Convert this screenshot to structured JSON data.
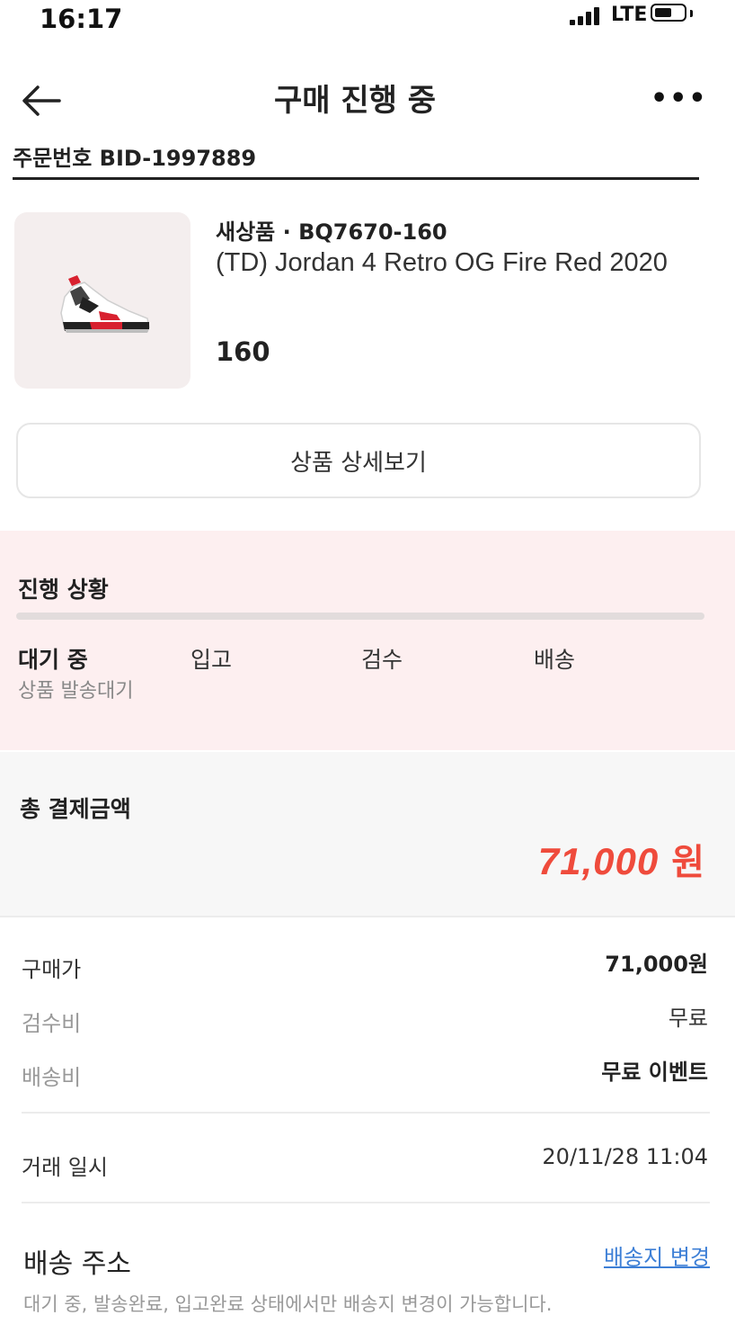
{
  "status_bar": {
    "time": "16:17",
    "network": "LTE",
    "signal_icon": "signal-bars-icon",
    "battery_icon": "battery-icon"
  },
  "header": {
    "title": "구매 진행 중",
    "back_icon": "back-arrow-icon",
    "more_icon": "more-dots-icon",
    "more_glyph": "•••"
  },
  "order": {
    "number_text": "주문번호 BID-1997889"
  },
  "product": {
    "image_icon": "sneaker-image",
    "meta": "새상품 · BQ7670-160",
    "name": "(TD) Jordan 4 Retro OG Fire Red 2020",
    "size": "160",
    "detail_button": "상품 상세보기"
  },
  "progress": {
    "title": "진행 상황",
    "fill_fraction": 0.0,
    "steps": [
      {
        "label": "대기 중",
        "active": true
      },
      {
        "label": "입고",
        "active": false
      },
      {
        "label": "검수",
        "active": false
      },
      {
        "label": "배송",
        "active": false
      }
    ],
    "current_sub": "상품 발송대기"
  },
  "total": {
    "label": "총 결제금액",
    "amount": "71,000",
    "unit": "원",
    "color": "#ef4b3c"
  },
  "details": {
    "rows": [
      {
        "label": "구매가",
        "value": "71,000원"
      },
      {
        "label": "검수비",
        "value": "무료"
      },
      {
        "label": "배송비",
        "value": "무료 이벤트"
      }
    ],
    "trade_date_label": "거래 일시",
    "trade_date_value": "20/11/28 11:04"
  },
  "shipping": {
    "title": "배송 주소",
    "change_link": "배송지 변경",
    "link_color": "#3d7fd6",
    "note": "대기 중, 발송완료, 입고완료 상태에서만 배송지 변경이 가능합니다."
  }
}
